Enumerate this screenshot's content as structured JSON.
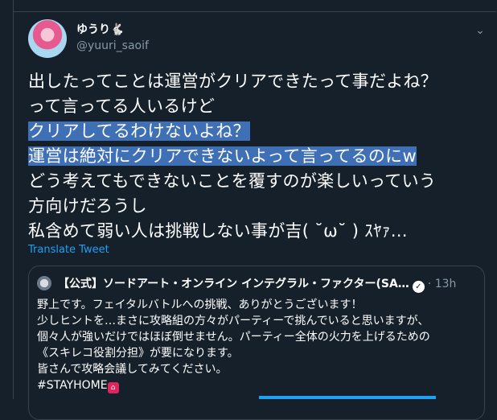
{
  "tweet": {
    "display_name": "ゆうり🐇",
    "username": "@yuuri_saoif",
    "lines": [
      "出したってことは運営がクリアできたって事だよね？",
      "って言ってる人いるけど",
      "クリアしてるわけないよね？",
      "運営は絶対にクリアできないよって言ってるのにw",
      "どう考えてもできないことを覆すのが楽しいっていう",
      "方向けだろうし",
      "私含めて弱い人は挑戦しない事が吉( ˘ω˘ ) ｽﾔｧ…"
    ],
    "highlighted_lines": [
      2,
      3
    ],
    "translate_label": "Translate Tweet"
  },
  "quote": {
    "name": "【公式】ソードアート・オンライン インテグラル・ファクター(SA…",
    "time": "· 13h",
    "lines": [
      "野上です。フェイタルバトルへの挑戦、ありがとうございます！",
      "少しヒントを…まさに攻略組の方々がパーティーで挑んでいると思いますが、",
      "個々人が強いだけではほぼ倒せません。パーティー全体の火力を上げるための",
      "《スキレコ役割分担》が要になります。",
      "皆さんで攻略会議してみてください。",
      "#STAYHOME"
    ]
  },
  "colors": {
    "background": "#15202b",
    "border": "#38444d",
    "secondary_text": "#8899a6",
    "link": "#1da1f2",
    "highlight": "#3f6fb5"
  },
  "icons": [
    "avatar",
    "chevron-down-icon",
    "verified-badge-icon",
    "stayhome-house-icon"
  ]
}
